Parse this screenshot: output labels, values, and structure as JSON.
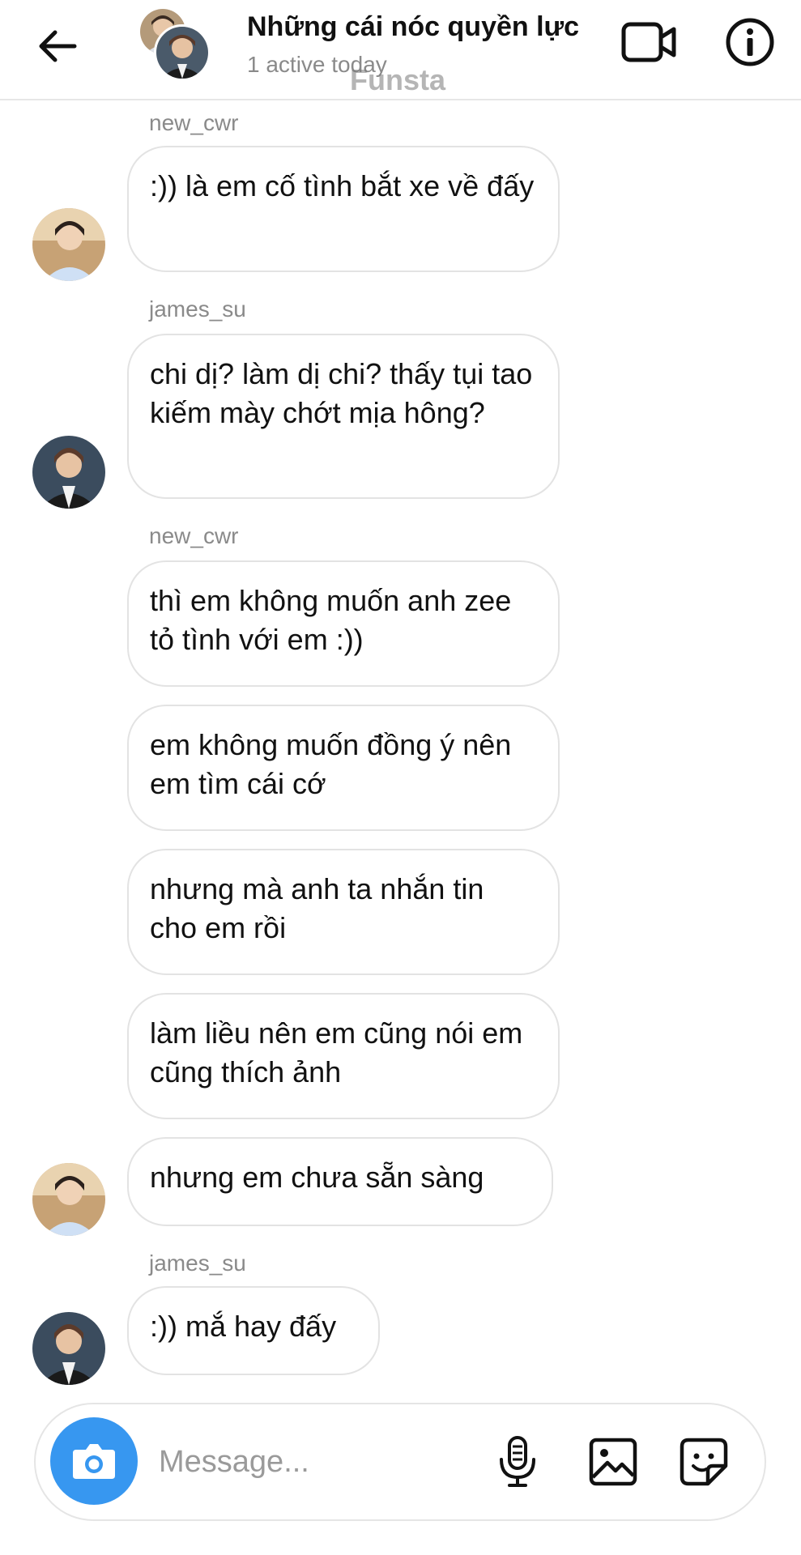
{
  "header": {
    "title": "Những cái nóc quyền lực",
    "status": "1 active today",
    "watermark": "Funsta"
  },
  "icons": {
    "back": "arrow-left-icon",
    "video": "video-camera-icon",
    "info": "info-circle-icon",
    "camera": "camera-icon",
    "mic": "microphone-icon",
    "gallery": "image-icon",
    "sticker": "sticker-icon"
  },
  "colors": {
    "accent": "#3797f0",
    "bubble_border": "#e3e3e3",
    "meta_text": "#8a8a8a"
  },
  "messages": [
    {
      "sender": "new_cwr",
      "text": ":)) là em cố tình bắt xe về đấy"
    },
    {
      "sender": "james_su",
      "text": "chi dị? làm dị chi? thấy tụi tao kiếm mày chớt mịa hông?"
    },
    {
      "sender": "new_cwr",
      "text": "thì em không muốn anh zee tỏ tình với em :))"
    },
    {
      "sender": "",
      "text": "em không muốn đồng ý nên em tìm cái cớ"
    },
    {
      "sender": "",
      "text": "nhưng mà anh ta nhắn tin cho em rồi"
    },
    {
      "sender": "",
      "text": "làm liều nên em cũng nói em cũng thích ảnh"
    },
    {
      "sender": "",
      "text": "nhưng em chưa sẵn sàng"
    },
    {
      "sender": "james_su",
      "text": ":)) mắ hay đấy"
    }
  ],
  "composer": {
    "placeholder": "Message..."
  }
}
